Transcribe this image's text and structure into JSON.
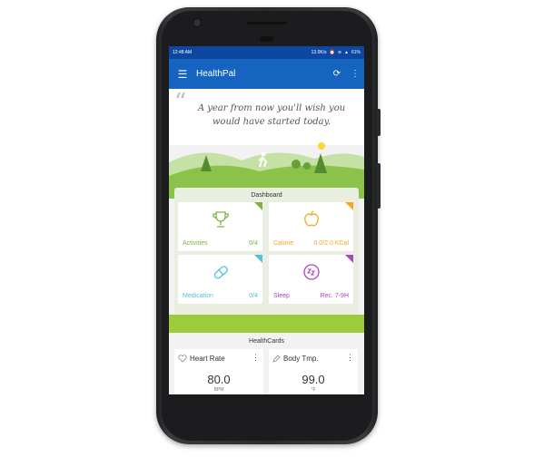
{
  "status_bar": {
    "time": "12:48 AM",
    "network": "13.0K/s",
    "battery": "61%"
  },
  "app_bar": {
    "title": "HealthPal",
    "menu_icon": "hamburger-menu-icon",
    "sync_icon": "sync-icon",
    "more_icon": "more-vert-icon"
  },
  "quote": {
    "text": "A year from now you'll wish you would have started today."
  },
  "dashboard": {
    "title": "Dashboard",
    "tiles": [
      {
        "label": "Activities",
        "value": "0/4",
        "icon": "trophy-icon",
        "color": "#7cb342"
      },
      {
        "label": "Calorie",
        "value": "0.0/2.0 KCal",
        "icon": "apple-icon",
        "color": "#f5a623"
      },
      {
        "label": "Medication",
        "value": "0/4",
        "icon": "pill-icon",
        "color": "#4fc3d9"
      },
      {
        "label": "Sleep",
        "value": "Rec. 7-9H",
        "icon": "sleep-zz-icon",
        "color": "#ab47bc"
      }
    ]
  },
  "health_cards": {
    "title": "HealthCards",
    "cards": [
      {
        "label": "Heart Rate",
        "value": "80.0",
        "unit": "BPM",
        "icon": "heart-pulse-icon"
      },
      {
        "label": "Body Tmp.",
        "value": "99.0",
        "unit": "°F",
        "icon": "pencil-icon"
      }
    ]
  }
}
